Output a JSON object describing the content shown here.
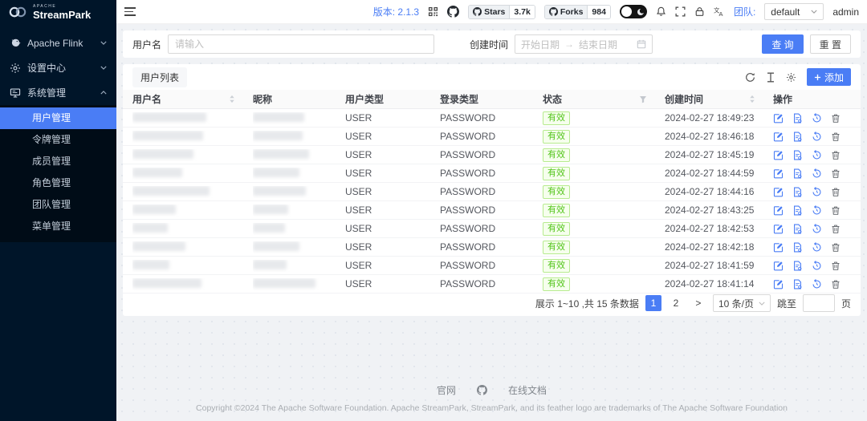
{
  "colors": {
    "accent": "#4a7df5",
    "sidebar_bg": "#001529",
    "submenu_bg": "#000c17",
    "status_text": "#52c41a",
    "status_bg": "#f6ffed",
    "status_border": "#b7eb8f"
  },
  "sidebar": {
    "logo_super": "APACHE",
    "logo_title": "StreamPark",
    "items": [
      {
        "label": "Apache Flink",
        "expanded": false
      },
      {
        "label": "设置中心",
        "expanded": false
      },
      {
        "label": "系统管理",
        "expanded": true
      }
    ],
    "subitems": [
      {
        "label": "用户管理",
        "active": true
      },
      {
        "label": "令牌管理",
        "active": false
      },
      {
        "label": "成员管理",
        "active": false
      },
      {
        "label": "角色管理",
        "active": false
      },
      {
        "label": "团队管理",
        "active": false
      },
      {
        "label": "菜单管理",
        "active": false
      }
    ]
  },
  "header": {
    "version_label": "版本:",
    "version_value": "2.1.3",
    "stars_label": "Stars",
    "stars_value": "3.7k",
    "forks_label": "Forks",
    "forks_value": "984",
    "team_label": "团队:",
    "team_value": "default",
    "user": "admin"
  },
  "filter": {
    "username_label": "用户名",
    "username_placeholder": "请输入",
    "created_label": "创建时间",
    "date_start_placeholder": "开始日期",
    "date_separator": "→",
    "date_end_placeholder": "结束日期",
    "search_button": "查 询",
    "reset_button": "重 置"
  },
  "table": {
    "title": "用户列表",
    "add_button": "添加",
    "columns": [
      "用户名",
      "昵称",
      "用户类型",
      "登录类型",
      "状态",
      "创建时间",
      "操作"
    ],
    "rows": [
      {
        "user_type": "USER",
        "login_type": "PASSWORD",
        "status": "有效",
        "created_at": "2024-02-27 18:49:23",
        "name_w": 92,
        "nick_w": 64
      },
      {
        "user_type": "USER",
        "login_type": "PASSWORD",
        "status": "有效",
        "created_at": "2024-02-27 18:46:18",
        "name_w": 88,
        "nick_w": 62
      },
      {
        "user_type": "USER",
        "login_type": "PASSWORD",
        "status": "有效",
        "created_at": "2024-02-27 18:45:19",
        "name_w": 76,
        "nick_w": 70
      },
      {
        "user_type": "USER",
        "login_type": "PASSWORD",
        "status": "有效",
        "created_at": "2024-02-27 18:44:59",
        "name_w": 62,
        "nick_w": 58
      },
      {
        "user_type": "USER",
        "login_type": "PASSWORD",
        "status": "有效",
        "created_at": "2024-02-27 18:44:16",
        "name_w": 96,
        "nick_w": 66
      },
      {
        "user_type": "USER",
        "login_type": "PASSWORD",
        "status": "有效",
        "created_at": "2024-02-27 18:43:25",
        "name_w": 54,
        "nick_w": 44
      },
      {
        "user_type": "USER",
        "login_type": "PASSWORD",
        "status": "有效",
        "created_at": "2024-02-27 18:42:53",
        "name_w": 44,
        "nick_w": 40
      },
      {
        "user_type": "USER",
        "login_type": "PASSWORD",
        "status": "有效",
        "created_at": "2024-02-27 18:42:18",
        "name_w": 66,
        "nick_w": 58
      },
      {
        "user_type": "USER",
        "login_type": "PASSWORD",
        "status": "有效",
        "created_at": "2024-02-27 18:41:59",
        "name_w": 46,
        "nick_w": 42
      },
      {
        "user_type": "USER",
        "login_type": "PASSWORD",
        "status": "有效",
        "created_at": "2024-02-27 18:41:14",
        "name_w": 86,
        "nick_w": 78
      }
    ]
  },
  "pagination": {
    "total_text": "展示 1~10 ,共 15 条数据",
    "pages": [
      "1",
      "2"
    ],
    "active_page": "1",
    "next": ">",
    "page_size": "10 条/页",
    "jump_label": "跳至",
    "jump_suffix": "页"
  },
  "footer": {
    "site_link": "官网",
    "docs_link": "在线文档",
    "copyright": "Copyright ©2024 The Apache Software Foundation. Apache StreamPark, StreamPark, and its feather logo are trademarks of The Apache Software Foundation"
  }
}
